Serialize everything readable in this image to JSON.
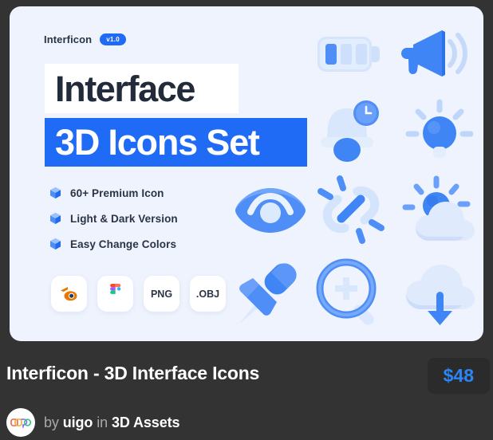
{
  "card": {
    "brand": "Interficon",
    "version_badge": "v1.0",
    "headline_line1": "Interface",
    "headline_line2": "3D Icons Set",
    "features": [
      {
        "icon": "cube-icon",
        "label": "60+ Premium Icon"
      },
      {
        "icon": "cube-icon",
        "label": "Light & Dark Version"
      },
      {
        "icon": "cube-icon",
        "label": "Easy Change Colors"
      }
    ],
    "formats": [
      {
        "icon": "blender-icon",
        "label": ""
      },
      {
        "icon": "figma-icon",
        "label": ""
      },
      {
        "icon": "png-label",
        "label": "PNG"
      },
      {
        "icon": "obj-label",
        "label": ".OBJ"
      }
    ],
    "preview_icons": [
      "battery-icon",
      "megaphone-icon",
      "bell-clock-icon",
      "lightbulb-icon",
      "eye-icon",
      "broken-link-icon",
      "partly-cloudy-icon",
      "pushpin-icon",
      "zoom-in-icon",
      "cloud-download-icon"
    ]
  },
  "footer": {
    "product_title": "Interficon - 3D Interface Icons",
    "price": "$48",
    "by_label": "by",
    "author": "uigo",
    "in_label": "in",
    "category": "3D Assets"
  },
  "colors": {
    "accent_blue": "#1f6bf5",
    "price_blue": "#2b85f5",
    "card_bg": "#eef3fd",
    "page_bg": "#333333",
    "headline_dark": "#222b3a"
  }
}
